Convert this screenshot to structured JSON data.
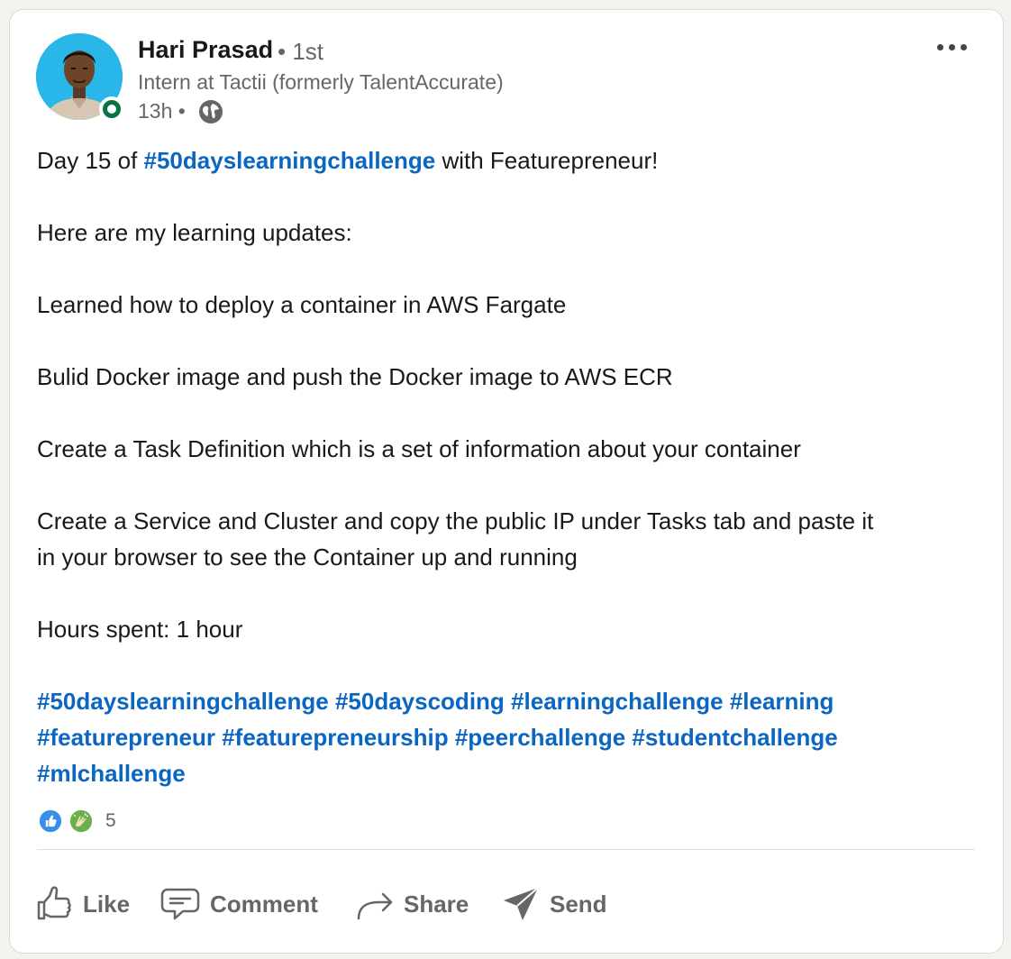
{
  "post": {
    "author": {
      "name": "Hari Prasad",
      "degree": "• 1st",
      "headline": "Intern at Tactii (formerly TalentAccurate)",
      "timestamp": "13h •",
      "presence_color": "#057642"
    },
    "body": {
      "line1_prefix": "Day 15 of ",
      "line1_hashtag": "#50dayslearningchallenge",
      "line1_suffix": " with Featurepreneur!",
      "line2": "Here are my learning updates:",
      "line3": "Learned how to deploy a container in AWS Fargate",
      "line4": "Bulid Docker image and push the Docker image to AWS ECR",
      "line5": "Create a Task Definition which is a set of information about your container",
      "line6a": "Create a Service and Cluster and copy the public IP under Tasks tab and paste it",
      "line6b": "in your browser to see the Container up and running",
      "line7": "Hours spent: 1 hour"
    },
    "hashtags": [
      "#50dayslearningchallenge",
      "#50dayscoding",
      "#learningchallenge",
      "#learning",
      "#featurepreneur",
      "#featurepreneurship",
      "#peerchallenge",
      "#studentchallenge",
      "#mlchallenge"
    ],
    "reactions": {
      "icons": [
        "like-reaction-icon",
        "celebrate-reaction-icon"
      ],
      "count": "5"
    },
    "actions": {
      "like": "Like",
      "comment": "Comment",
      "share": "Share",
      "send": "Send"
    }
  },
  "colors": {
    "link": "#0a66c2",
    "secondary_text": "#666666",
    "avatar_bg": "#29b6e8"
  }
}
